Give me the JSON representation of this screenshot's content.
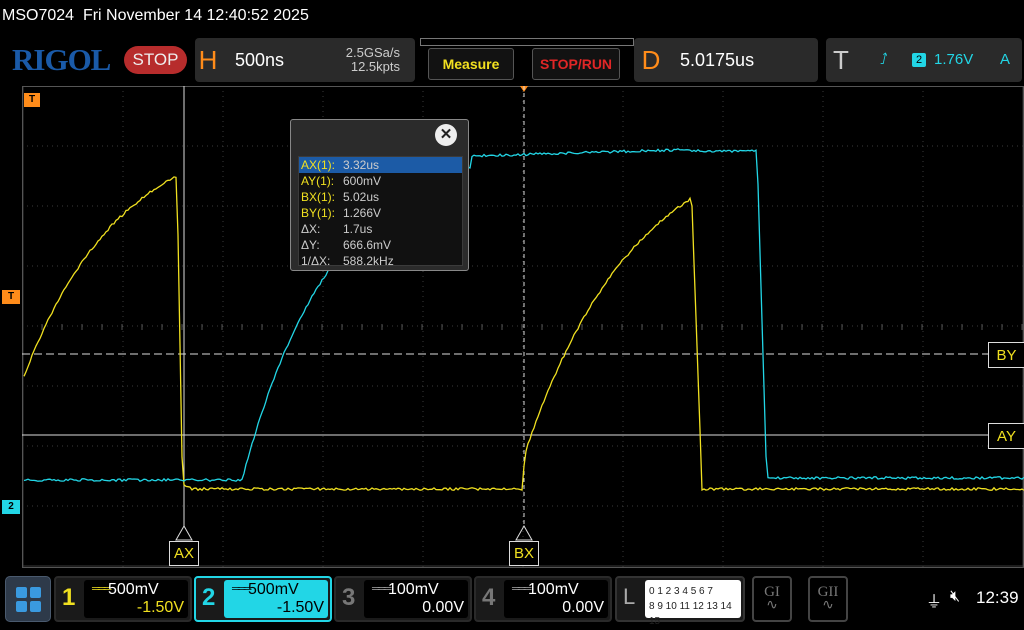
{
  "status_line": {
    "model": "MSO7024",
    "datetime": "Fri November 14 12:40:52 2025"
  },
  "top_bar": {
    "logo": "RIGOL",
    "run_state": "STOP",
    "horizontal": {
      "letter": "H",
      "timebase": "500ns",
      "sample_rate": "2.5GSa/s",
      "memory_depth": "12.5kpts"
    },
    "measure_button": "Measure",
    "stop_run_button": "STOP/RUN",
    "delay": {
      "letter": "D",
      "value": "5.0175us"
    },
    "trigger": {
      "letter": "T",
      "source_channel": "2",
      "level": "1.76V",
      "mode": "A"
    }
  },
  "screen": {
    "markers": {
      "trigger_top": "T",
      "trigger_level": "T",
      "channel2": "2"
    },
    "cursor_labels": {
      "ax": "AX",
      "bx": "BX",
      "ay": "AY",
      "by": "BY"
    }
  },
  "measure_popup": {
    "close_symbol": "✕",
    "rows": [
      {
        "label": "AX(1):",
        "value": "3.32us",
        "selected": true
      },
      {
        "label": "AY(1):",
        "value": "600mV"
      },
      {
        "label": "BX(1):",
        "value": "5.02us"
      },
      {
        "label": "BY(1):",
        "value": "1.266V"
      },
      {
        "label": "ΔX:",
        "value": "1.7us"
      },
      {
        "label": "ΔY:",
        "value": "666.6mV"
      },
      {
        "label": "1/ΔX:",
        "value": "588.2kHz"
      }
    ]
  },
  "bottom_bar": {
    "channels": [
      {
        "number": "1",
        "scale": "500mV",
        "offset": "-1.50V",
        "color": "#f0e020",
        "active": true
      },
      {
        "number": "2",
        "scale": "500mV",
        "offset": "-1.50V",
        "color": "#22d6e6",
        "active": true
      },
      {
        "number": "3",
        "scale": "100mV",
        "offset": "0.00V",
        "color": "#9a9a9a",
        "active": false
      },
      {
        "number": "4",
        "scale": "100mV",
        "offset": "0.00V",
        "color": "#9a9a9a",
        "active": false
      }
    ],
    "logic": {
      "letter": "L",
      "row1": "0 1 2 3   4 5 6 7",
      "row2": "8 9 10 11  12 13 14 15"
    },
    "decoders": [
      "GI",
      "GII"
    ],
    "clock": "12:39"
  },
  "colors": {
    "ch1": "#f0e020",
    "ch2": "#22d6e6",
    "trigger": "#ff8c1a",
    "accent": "#1c5ba6"
  }
}
